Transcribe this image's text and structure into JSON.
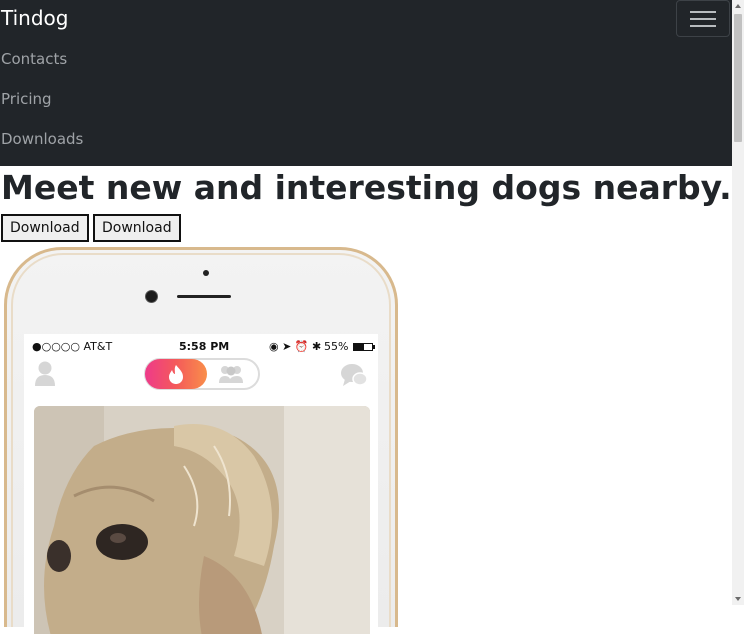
{
  "navbar": {
    "brand": "Tindog",
    "links": [
      "Contacts",
      "Pricing",
      "Downloads"
    ],
    "toggler_icon": "hamburger-icon"
  },
  "hero": {
    "headline": "Meet new and interesting dogs nearby.",
    "buttons": [
      "Download",
      "Download"
    ]
  },
  "phone": {
    "status": {
      "carrier": "●○○○○ AT&T",
      "time": "5:58 PM",
      "icons": "◉ ➤ ⏰ ✱",
      "battery": "55%"
    },
    "app_icons": [
      "profile-icon",
      "flame-icon",
      "group-icon",
      "chat-icon"
    ],
    "photo_subject": "dog-photo"
  },
  "colors": {
    "navbar_bg": "#212529",
    "brand_text": "#ffffff",
    "link_text": "#9fa3a7",
    "flame_gradient_start": "#ee3a8a",
    "flame_gradient_end": "#f98e4a",
    "phone_frame": "#d8b98d"
  }
}
